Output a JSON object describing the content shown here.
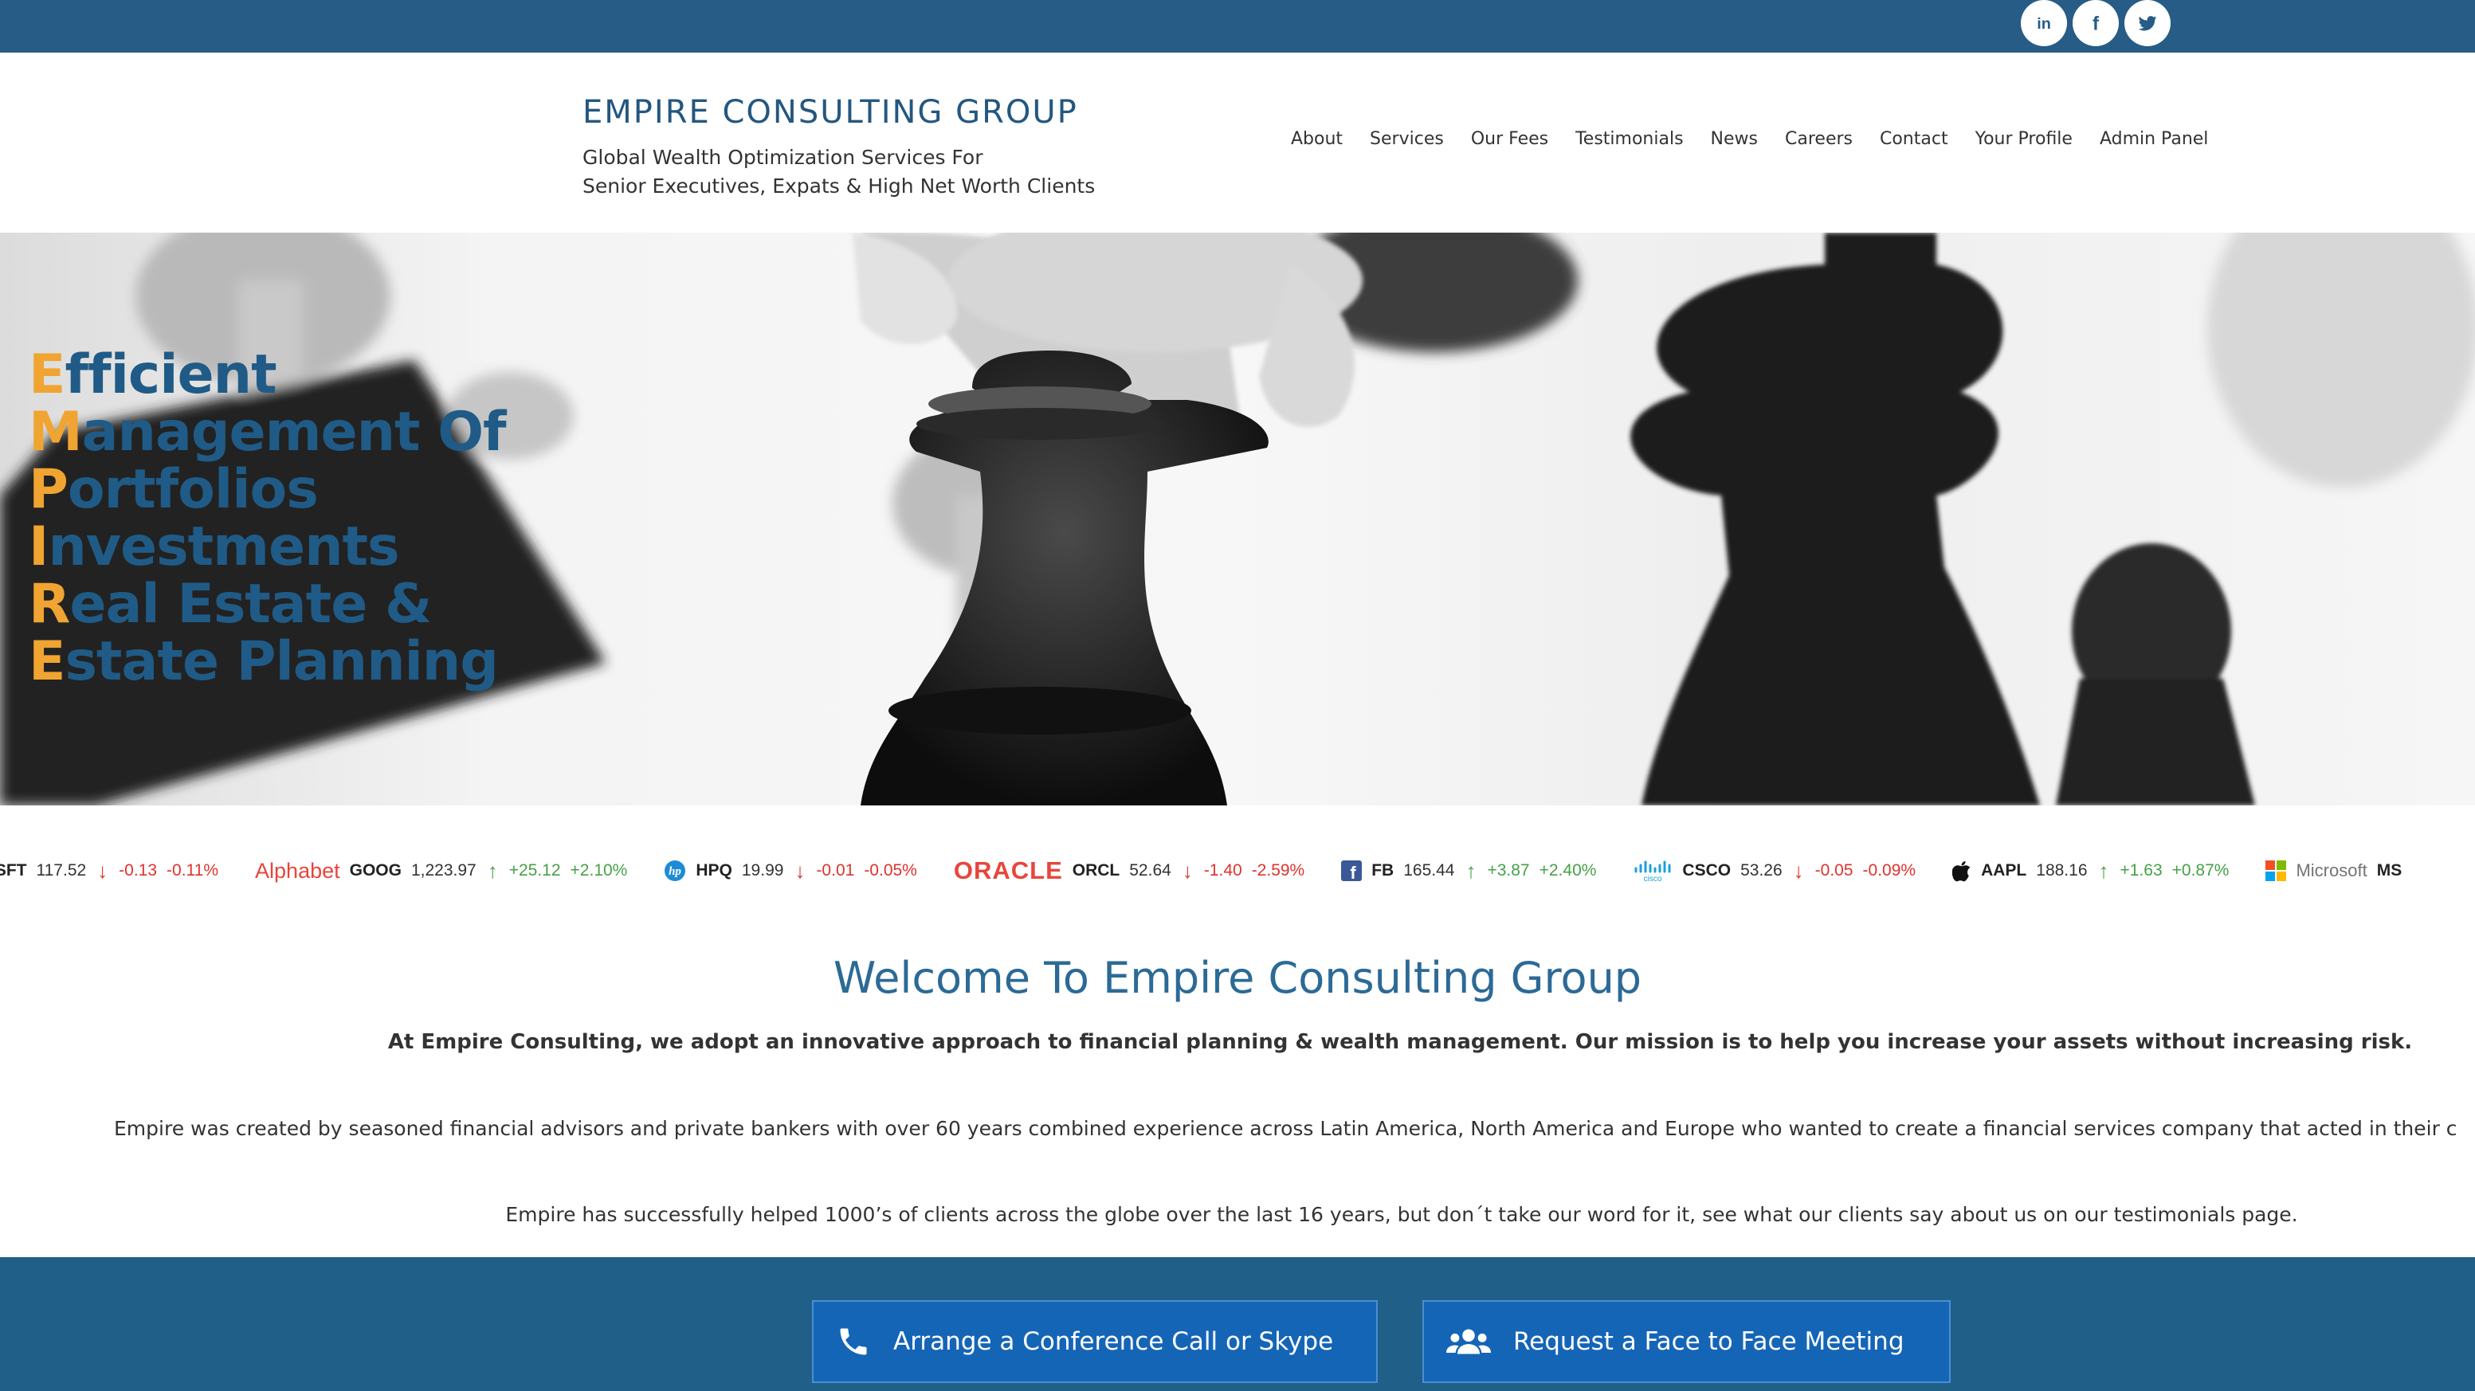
{
  "social": [
    {
      "name": "linkedin",
      "glyph": "in"
    },
    {
      "name": "facebook",
      "glyph": "f"
    },
    {
      "name": "twitter",
      "glyph": "t"
    }
  ],
  "brand": {
    "title": "EMPIRE CONSULTING GROUP",
    "tagline_line1": "Global Wealth Optimization Services For",
    "tagline_line2": "Senior Executives, Expats & High Net Worth Clients"
  },
  "nav": [
    "About",
    "Services",
    "Our Fees",
    "Testimonials",
    "News",
    "Careers",
    "Contact",
    "Your Profile",
    "Admin Panel"
  ],
  "hero": {
    "lines": [
      {
        "initial": "E",
        "rest": "fficient"
      },
      {
        "initial": "M",
        "rest": "anagement Of"
      },
      {
        "initial": "P",
        "rest": "ortfolios"
      },
      {
        "initial": "I",
        "rest": "nvestments"
      },
      {
        "initial": "R",
        "rest": "eal Estate &"
      },
      {
        "initial": "E",
        "rest": "state Planning"
      }
    ]
  },
  "ticker": [
    {
      "logo": "",
      "symbol": "ISFT",
      "price": "117.52",
      "dir": "down",
      "change": "-0.13",
      "pct": "-0.11%"
    },
    {
      "logo": "Alphabet",
      "symbol": "GOOG",
      "price": "1,223.97",
      "dir": "up",
      "change": "+25.12",
      "pct": "+2.10%"
    },
    {
      "logo": "hp-icon",
      "symbol": "HPQ",
      "price": "19.99",
      "dir": "down",
      "change": "-0.01",
      "pct": "-0.05%"
    },
    {
      "logo": "ORACLE",
      "symbol": "ORCL",
      "price": "52.64",
      "dir": "down",
      "change": "-1.40",
      "pct": "-2.59%"
    },
    {
      "logo": "facebook-icon",
      "symbol": "FB",
      "price": "165.44",
      "dir": "up",
      "change": "+3.87",
      "pct": "+2.40%"
    },
    {
      "logo": "cisco-icon",
      "symbol": "CSCO",
      "price": "53.26",
      "dir": "down",
      "change": "-0.05",
      "pct": "-0.09%"
    },
    {
      "logo": "apple-icon",
      "symbol": "AAPL",
      "price": "188.16",
      "dir": "up",
      "change": "+1.63",
      "pct": "+0.87%"
    },
    {
      "logo": "Microsoft",
      "symbol": "MS",
      "price": "",
      "dir": "",
      "change": "",
      "pct": ""
    }
  ],
  "welcome": {
    "title": "Welcome To Empire Consulting Group",
    "lead": "At Empire Consulting, we adopt an innovative approach to financial planning & wealth management. Our mission is to help you increase your assets without increasing risk.",
    "para1": "Empire was created by seasoned financial advisors and private bankers with over 60 years combined experience across Latin America, North America and Europe who wanted to create a financial services company that acted in their c",
    "para2": "Empire has successfully helped 1000’s of clients across the globe over the last 16 years, but don´t take our word for it, see what our clients say about us on our testimonials page."
  },
  "cta": {
    "call_label": "Arrange a Conference Call or Skype",
    "meeting_label": "Request a Face to Face Meeting"
  },
  "colors": {
    "topbar": "#265c85",
    "brand_blue": "#24577f",
    "accent_orange": "#f0a431",
    "down": "#e0322d",
    "up": "#46a148",
    "cta_bg": "#1f5f88",
    "button": "#1565b7"
  }
}
